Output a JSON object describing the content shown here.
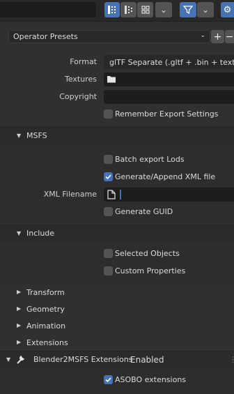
{
  "toolbar": {
    "view_buttons": [
      "list-vertical-icon",
      "list-horizontal-icon",
      "grid-icon"
    ],
    "filter_icon": "filter-icon",
    "settings_icon": "gear-icon"
  },
  "presets": {
    "label": "Operator Presets",
    "add": "+",
    "remove": "−"
  },
  "main": {
    "format_label": "Format",
    "format_value": "glTF Separate (.gltf + .bin + textu...",
    "textures_label": "Textures",
    "copyright_label": "Copyright",
    "remember_label": "Remember Export Settings"
  },
  "msfs": {
    "title": "MSFS",
    "batch_label": "Batch export Lods",
    "xml_label": "Generate/Append XML file",
    "xml_filename_label": "XML Filename",
    "guid_label": "Generate GUID"
  },
  "include": {
    "title": "Include",
    "selected_label": "Selected Objects",
    "custom_label": "Custom Properties"
  },
  "collapsed": [
    "Transform",
    "Geometry",
    "Animation",
    "Extensions"
  ],
  "b2m": {
    "title": "Blender2MSFS Extensions",
    "status": "Enabled",
    "asobo_label": "ASOBO extensions"
  },
  "colors": {
    "accent": "#4772b3",
    "bg": "#303030",
    "field": "#1d1d1d"
  }
}
